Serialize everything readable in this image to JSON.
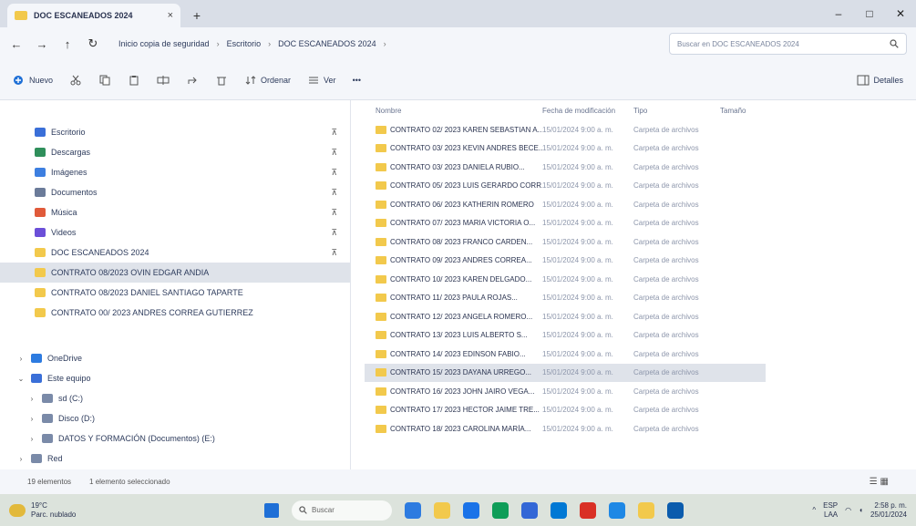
{
  "window": {
    "tab_title": "DOC ESCANEADOS 2024",
    "tab_close": "×",
    "tab_add": "+",
    "controls": [
      "–",
      "□",
      "✕"
    ]
  },
  "address": {
    "back": "←",
    "forward": "→",
    "up": "↑",
    "refresh": "↻",
    "crumbs": [
      "Inicio copia de seguridad",
      "Escritorio",
      "DOC ESCANEADOS 2024"
    ],
    "separator": "›",
    "search_placeholder": "Buscar en DOC ESCANEADOS 2024"
  },
  "commands": {
    "new": "Nuevo",
    "sort": "Ordenar",
    "view": "Ver",
    "more": "•••",
    "details": "Detalles"
  },
  "sidebar": {
    "quick_access": [
      {
        "label": "Escritorio",
        "color": "#3a6fd8"
      },
      {
        "label": "Descargas",
        "color": "#2f8f5b"
      },
      {
        "label": "Imágenes",
        "color": "#3d7fe0"
      },
      {
        "label": "Documentos",
        "color": "#6b7b99"
      },
      {
        "label": "Música",
        "color": "#e05a3a"
      },
      {
        "label": "Videos",
        "color": "#6b4fd8"
      },
      {
        "label": "DOC ESCANEADOS 2024",
        "color": "#f2c94c"
      },
      {
        "label": "CONTRATO 08/2023 OVIN EDGAR ANDIA",
        "color": "#f2c94c"
      },
      {
        "label": "CONTRATO 08/2023 DANIEL SANTIAGO TAPARTE",
        "color": "#f2c94c"
      },
      {
        "label": "CONTRATO 00/ 2023 ANDRES CORREA GUTIERREZ",
        "color": "#f2c94c"
      }
    ],
    "pin": "📌",
    "tree": [
      {
        "chev": "›",
        "label": "OneDrive",
        "color": "#2d7be0"
      },
      {
        "chev": "⌄",
        "label": "Este equipo",
        "color": "#3a6fd8"
      },
      {
        "chev": "›",
        "label": "sd (C:)",
        "color": "#7a8aa8"
      },
      {
        "chev": "›",
        "label": "Disco (D:)",
        "color": "#7a8aa8"
      },
      {
        "chev": "›",
        "label": "DATOS Y FORMACIÓN (Documentos) (E:)",
        "color": "#7a8aa8"
      },
      {
        "chev": "›",
        "label": "Red",
        "color": "#7a8aa8"
      }
    ]
  },
  "files": {
    "headers": {
      "name": "Nombre",
      "date": "Fecha de modificación",
      "type": "Tipo",
      "size": "Tamaño"
    },
    "rows": [
      {
        "name": "CONTRATO 02/ 2023 KAREN SEBASTIAN A...",
        "date": "15/01/2024 9:00 a. m.",
        "type": "Carpeta de archivos"
      },
      {
        "name": "CONTRATO 03/ 2023 KEVIN ANDRES BECE...",
        "date": "15/01/2024 9:00 a. m.",
        "type": "Carpeta de archivos"
      },
      {
        "name": "CONTRATO 03/ 2023 DANIELA RUBIO...",
        "date": "15/01/2024 9:00 a. m.",
        "type": "Carpeta de archivos"
      },
      {
        "name": "CONTRATO 05/ 2023 LUIS GERARDO CORR...",
        "date": "15/01/2024 9:00 a. m.",
        "type": "Carpeta de archivos"
      },
      {
        "name": "CONTRATO 06/ 2023 KATHERIN ROMERO",
        "date": "15/01/2024 9:00 a. m.",
        "type": "Carpeta de archivos"
      },
      {
        "name": "CONTRATO 07/ 2023 MARIA VICTORIA O...",
        "date": "15/01/2024 9:00 a. m.",
        "type": "Carpeta de archivos"
      },
      {
        "name": "CONTRATO 08/ 2023 FRANCO CARDEN...",
        "date": "15/01/2024 9:00 a. m.",
        "type": "Carpeta de archivos"
      },
      {
        "name": "CONTRATO 09/ 2023 ANDRES CORREA...",
        "date": "15/01/2024 9:00 a. m.",
        "type": "Carpeta de archivos"
      },
      {
        "name": "CONTRATO 10/ 2023 KAREN DELGADO...",
        "date": "15/01/2024 9:00 a. m.",
        "type": "Carpeta de archivos"
      },
      {
        "name": "CONTRATO 11/ 2023 PAULA ROJAS...",
        "date": "15/01/2024 9:00 a. m.",
        "type": "Carpeta de archivos"
      },
      {
        "name": "CONTRATO 12/ 2023 ANGELA ROMERO...",
        "date": "15/01/2024 9:00 a. m.",
        "type": "Carpeta de archivos"
      },
      {
        "name": "CONTRATO 13/ 2023 LUIS ALBERTO S...",
        "date": "15/01/2024 9:00 a. m.",
        "type": "Carpeta de archivos"
      },
      {
        "name": "CONTRATO 14/ 2023 EDINSON FABIO...",
        "date": "15/01/2024 9:00 a. m.",
        "type": "Carpeta de archivos"
      },
      {
        "name": "CONTRATO 15/ 2023 DAYANA URREGO...",
        "date": "15/01/2024 9:00 a. m.",
        "type": "Carpeta de archivos"
      },
      {
        "name": "CONTRATO 16/ 2023 JOHN JAIRO VEGA...",
        "date": "15/01/2024 9:00 a. m.",
        "type": "Carpeta de archivos"
      },
      {
        "name": "CONTRATO 17/ 2023 HECTOR JAIME TRE...",
        "date": "15/01/2024 9:00 a. m.",
        "type": "Carpeta de archivos"
      },
      {
        "name": "CONTRATO 18/ 2023 CAROLINA MARÍA...",
        "date": "15/01/2024 9:00 a. m.",
        "type": "Carpeta de archivos"
      }
    ]
  },
  "status": {
    "count": "19 elementos",
    "selected": "1 elemento seleccionado",
    "view_icons": "☰ ▦"
  },
  "taskbar": {
    "weather_temp": "19°C",
    "weather_desc": "Parc. nublado",
    "search_label": "Buscar",
    "apps": [
      "#2d7be0",
      "#f2c94c",
      "#1a73e8",
      "#0f9d58",
      "#3367d6",
      "#0078d4",
      "#d93025",
      "#1e88e5",
      "#f2c94c",
      "#0b5cad"
    ],
    "tray": "ESP",
    "tray_lang": "LAA",
    "time": "2:58 p. m.",
    "date": "25/01/2024"
  }
}
